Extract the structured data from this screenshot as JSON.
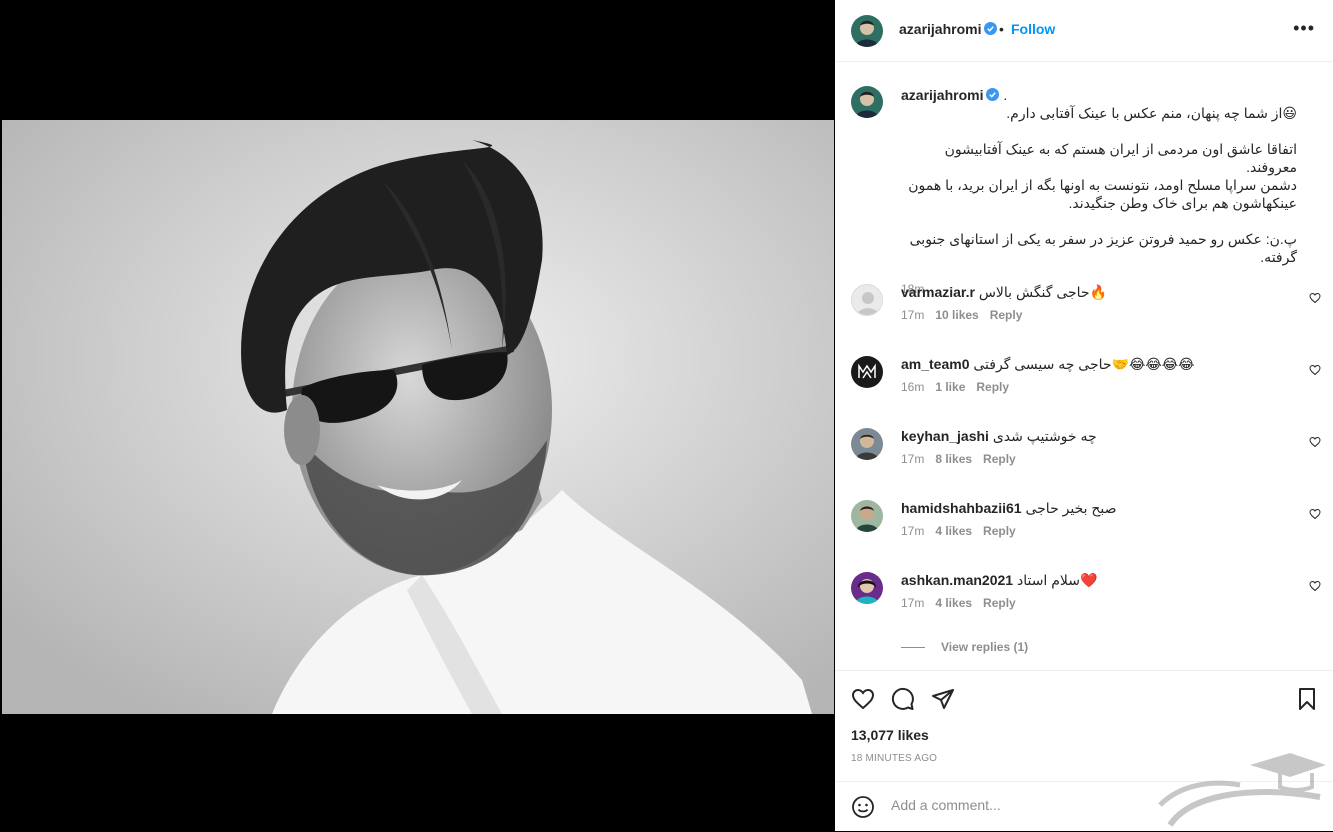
{
  "post": {
    "username": "azarijahromi",
    "follow_label": "Follow",
    "more_label": "•••",
    "sep": "•"
  },
  "caption": {
    "username": "azarijahromi",
    "trail": ".",
    "text": "😃از شما چه پنهان، منم عکس با عینک آفتابی دارم.\n\nاتفاقا عاشق اون مردمی از ایران هستم که به عینک آفتابیشون معروفند.\nدشمن سراپا مسلح اومد، نتونست به اونها بگه از ایران برید، با همون عینکهاشون هم برای خاک وطن جنگیدند.\n\nپ.ن: عکس رو حمید فروتن عزیز در سفر به یکی از استانهای جنوبی گرفته.",
    "time": "18m"
  },
  "comments": [
    {
      "username": "varmaziar.r",
      "text": "حاجی گنگش بالاس🔥",
      "time": "17m",
      "likes": "10 likes",
      "reply": "Reply"
    },
    {
      "username": "am_team0",
      "text": "حاجی چه سیسی گرفتی🤝😂😂😂😂",
      "time": "16m",
      "likes": "1 like",
      "reply": "Reply"
    },
    {
      "username": "keyhan_jashi",
      "text": "چه خوشتیپ شدی",
      "time": "17m",
      "likes": "8 likes",
      "reply": "Reply"
    },
    {
      "username": "hamidshahbazii61",
      "text": "صبح بخیر حاجی",
      "time": "17m",
      "likes": "4 likes",
      "reply": "Reply"
    },
    {
      "username": "ashkan.man2021",
      "text": "سلام استاد❤️",
      "time": "17m",
      "likes": "4 likes",
      "reply": "Reply"
    }
  ],
  "view_replies": "View replies (1)",
  "likes_count": "13,077 likes",
  "time_ago": "18 MINUTES AGO",
  "add_comment": {
    "placeholder": "Add a comment..."
  },
  "colors": {
    "accent": "#0095f6",
    "muted": "#8e8e8e",
    "text": "#262626"
  }
}
